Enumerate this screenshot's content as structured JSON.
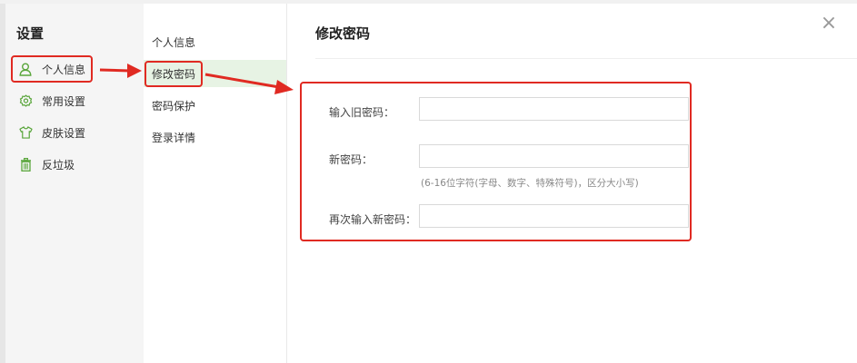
{
  "sidebar": {
    "title": "设置",
    "items": [
      {
        "label": "个人信息",
        "icon": "user-icon"
      },
      {
        "label": "常用设置",
        "icon": "gear-icon"
      },
      {
        "label": "皮肤设置",
        "icon": "shirt-icon"
      },
      {
        "label": "反垃圾",
        "icon": "trash-icon"
      }
    ]
  },
  "submenu": {
    "items": [
      {
        "label": "个人信息"
      },
      {
        "label": "修改密码"
      },
      {
        "label": "密码保护"
      },
      {
        "label": "登录详情"
      }
    ]
  },
  "content": {
    "title": "修改密码",
    "close_symbol": "×",
    "fields": {
      "old_password_label": "输入旧密码：",
      "new_password_label": "新密码：",
      "new_password_hint": "(6-16位字符(字母、数字、特殊符号)，区分大小写)",
      "confirm_password_label": "再次输入新密码："
    }
  },
  "colors": {
    "accent_green": "#5aa63c",
    "highlight_bg": "#e7f3e4",
    "annotation_red": "#e02a22"
  }
}
